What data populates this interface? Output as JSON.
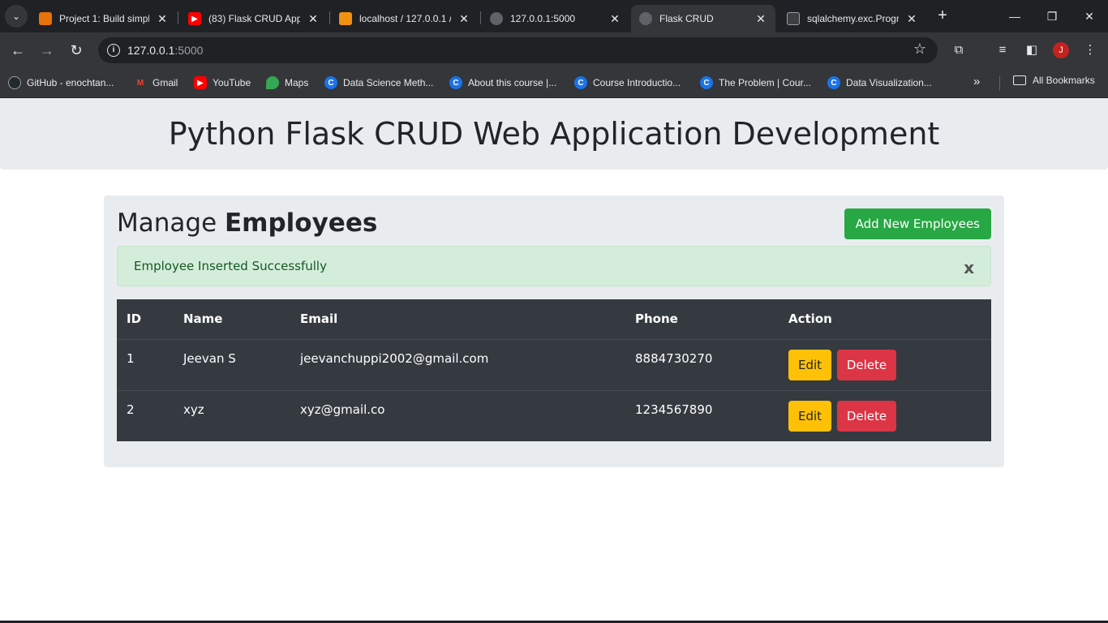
{
  "browser": {
    "tabs": [
      {
        "title": "Project 1: Build simpl",
        "favicon_color": "#e8710a"
      },
      {
        "title": "(83) Flask CRUD Appl",
        "favicon_color": "#ff0000"
      },
      {
        "title": "localhost / 127.0.0.1 /",
        "favicon_color": "#f29111"
      },
      {
        "title": "127.0.0.1:5000",
        "favicon_color": "#5f6368"
      },
      {
        "title": "Flask CRUD",
        "favicon_color": "#5f6368"
      },
      {
        "title": "sqlalchemy.exc.Progr",
        "favicon_color": "#3c4043"
      }
    ],
    "url_host": "127.0.0.1",
    "url_port": ":5000",
    "profile_initial": "J",
    "bookmarks": [
      {
        "label": "GitHub - enochtan...",
        "icon_color": "#24292e",
        "glyph": ""
      },
      {
        "label": "Gmail",
        "icon_color": "#ea4335",
        "glyph": "M"
      },
      {
        "label": "YouTube",
        "icon_color": "#ff0000",
        "glyph": "▶"
      },
      {
        "label": "Maps",
        "icon_color": "#34a853",
        "glyph": ""
      },
      {
        "label": "Data Science Meth...",
        "icon_color": "#1a73e8",
        "glyph": "C"
      },
      {
        "label": "About this course |...",
        "icon_color": "#1a73e8",
        "glyph": "C"
      },
      {
        "label": "Course Introductio...",
        "icon_color": "#1a73e8",
        "glyph": "C"
      },
      {
        "label": "The Problem | Cour...",
        "icon_color": "#1a73e8",
        "glyph": "C"
      },
      {
        "label": "Data Visualization...",
        "icon_color": "#1a73e8",
        "glyph": "C"
      }
    ],
    "all_bookmarks": "All Bookmarks"
  },
  "page": {
    "heading": "Python Flask CRUD Web Application Development",
    "section_title_prefix": "Manage ",
    "section_title_bold": "Employees",
    "add_button": "Add New Employees",
    "alert_message": "Employee Inserted Successfully",
    "alert_close": "x",
    "columns": [
      "ID",
      "Name",
      "Email",
      "Phone",
      "Action"
    ],
    "rows": [
      {
        "id": "1",
        "name": "Jeevan S",
        "email": "jeevanchuppi2002@gmail.com",
        "phone": "8884730270"
      },
      {
        "id": "2",
        "name": "xyz",
        "email": "xyz@gmail.co",
        "phone": "1234567890"
      }
    ],
    "edit_label": "Edit",
    "delete_label": "Delete"
  }
}
